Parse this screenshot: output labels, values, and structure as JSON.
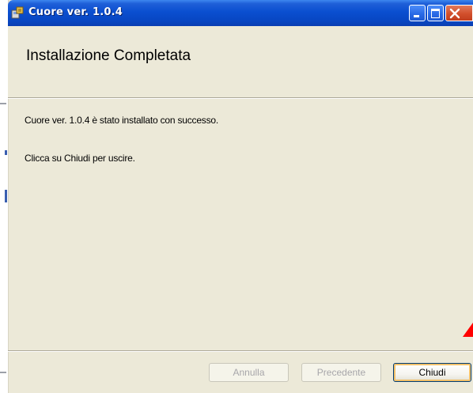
{
  "window": {
    "title": "Cuore ver. 1.0.4"
  },
  "header": {
    "title": "Installazione Completata"
  },
  "content": {
    "message": "Cuore ver. 1.0.4 è stato installato con successo.",
    "instruction": "Clicca su Chiudi per uscire."
  },
  "buttons": {
    "cancel_label": "Annulla",
    "back_label": "Precedente",
    "close_label": "Chiudi"
  },
  "colors": {
    "titlebar": "#0a4fd0",
    "dialog_bg": "#ece9d8",
    "close_button": "#d24f2c",
    "disabled_text": "#a7a6aa",
    "default_button_focus": "#f2c16b"
  },
  "icons": {
    "app": "installer-icon",
    "minimize": "minimize-icon",
    "maximize": "maximize-icon",
    "close": "close-icon"
  },
  "state": {
    "cancel_enabled": false,
    "back_enabled": false,
    "close_enabled": true
  }
}
